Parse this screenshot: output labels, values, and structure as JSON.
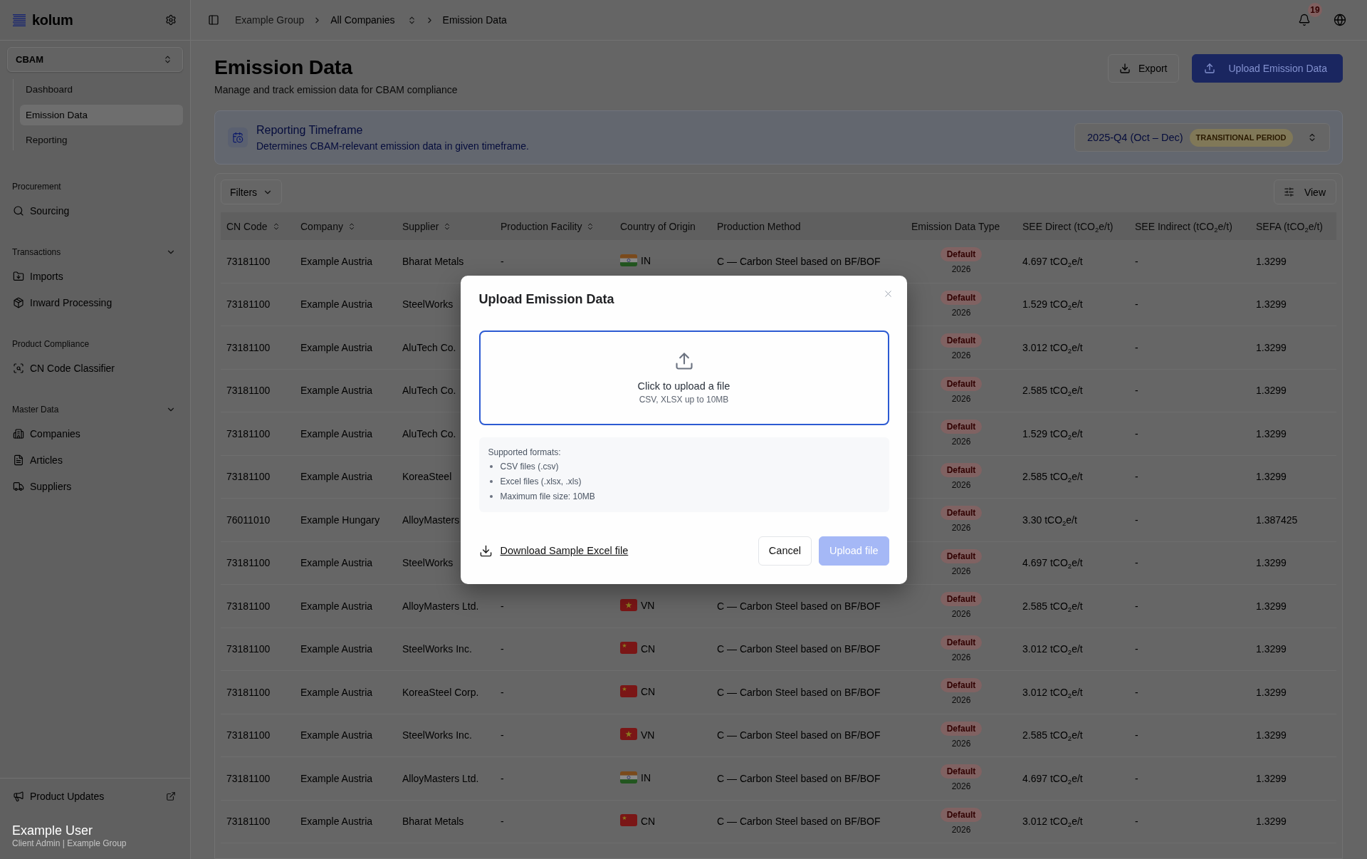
{
  "sidebar": {
    "logo": "kolum",
    "module": "CBAM",
    "module_items": [
      {
        "label": "Dashboard",
        "selected": false
      },
      {
        "label": "Emission Data",
        "selected": true
      },
      {
        "label": "Reporting",
        "selected": false
      }
    ],
    "sections": [
      {
        "title": "Procurement",
        "items": [
          {
            "label": "Sourcing",
            "selected": false
          }
        ]
      },
      {
        "title": "Transactions",
        "expanded": true,
        "items": [
          {
            "label": "Imports",
            "selected": false
          },
          {
            "label": "Inward Processing",
            "selected": false
          }
        ]
      },
      {
        "title": "Product Compliance",
        "items": [
          {
            "label": "CN Code Classifier",
            "selected": false
          }
        ]
      },
      {
        "title": "Master Data",
        "expanded": true,
        "items": [
          {
            "label": "Companies",
            "selected": false
          },
          {
            "label": "Articles",
            "selected": false
          },
          {
            "label": "Suppliers",
            "selected": false
          }
        ]
      }
    ],
    "product_updates": "Product Updates",
    "user": {
      "name": "Example User",
      "role": "Client Admin | Example Group"
    }
  },
  "header": {
    "breadcrumbs": [
      {
        "label": "Example Group",
        "kind": "link"
      },
      {
        "label": "All Companies",
        "kind": "switcher"
      },
      {
        "label": "Emission Data",
        "kind": "current"
      }
    ],
    "notification_count": "19"
  },
  "page": {
    "title": "Emission Data",
    "subtitle": "Manage and track emission data for CBAM compliance",
    "actions": [
      {
        "label": "Export",
        "kind": "secondary"
      },
      {
        "label": "Upload Emission Data",
        "kind": "primary"
      }
    ]
  },
  "reporting_timeframe": {
    "title": "Reporting Timeframe",
    "description": "Determines CBAM-relevant emission data in given timeframe.",
    "period": "2025-Q4 (Oct – Dec)",
    "period_badge": "TRANSITIONAL PERIOD"
  },
  "table": {
    "toolbar": {
      "filters": "Filters",
      "view": "View"
    },
    "columns": [
      {
        "label": "CN Code",
        "sortable": true
      },
      {
        "label": "Company",
        "sortable": true
      },
      {
        "label": "Supplier",
        "sortable": true
      },
      {
        "label": "Production Facility",
        "sortable": true
      },
      {
        "label": "Country of Origin",
        "sortable": false
      },
      {
        "label": "Production Method",
        "sortable": false
      },
      {
        "label": "Emission Data Type",
        "sortable": false
      },
      {
        "label": "SEE Direct (tCO$_{2}$e/t)",
        "sortable": false
      },
      {
        "label": "SEE Indirect (tCO$_{2}$e/t)",
        "sortable": false
      },
      {
        "label": "SEFA (tCO$_{2}$e/t)",
        "sortable": false
      }
    ],
    "rows": [
      {
        "cn_code": "73181100",
        "company": "Example Austria",
        "supplier": "Bharat Metals",
        "production_facility": "-",
        "country": {
          "code": "IN",
          "kind": "india"
        },
        "production_method": "C — Carbon Steel based on BF/BOF",
        "emission_data_type": {
          "label": "Default",
          "year": "2026"
        },
        "see_direct": "4.697 tCO$_{2}$e/t",
        "see_indirect": "-",
        "sefa": "1.3299"
      },
      {
        "cn_code": "73181100",
        "company": "Example Austria",
        "supplier": "SteelWorks",
        "emission_data_type": {
          "label": "Default",
          "year": "2026"
        },
        "see_direct": "1.529 tCO$_{2}$e/t",
        "see_indirect": "-",
        "sefa": "1.3299"
      },
      {
        "cn_code": "73181100",
        "company": "Example Austria",
        "supplier": "AluTech Co.",
        "emission_data_type": {
          "label": "Default",
          "year": "2026"
        },
        "see_direct": "3.012 tCO$_{2}$e/t",
        "see_indirect": "-",
        "sefa": "1.3299"
      },
      {
        "cn_code": "73181100",
        "company": "Example Austria",
        "supplier": "AluTech Co.",
        "emission_data_type": {
          "label": "Default",
          "year": "2026"
        },
        "see_direct": "2.585 tCO$_{2}$e/t",
        "see_indirect": "-",
        "sefa": "1.3299"
      },
      {
        "cn_code": "73181100",
        "company": "Example Austria",
        "supplier": "AluTech Co.",
        "emission_data_type": {
          "label": "Default",
          "year": "2026"
        },
        "see_direct": "1.529 tCO$_{2}$e/t",
        "see_indirect": "-",
        "sefa": "1.3299"
      },
      {
        "cn_code": "73181100",
        "company": "Example Austria",
        "supplier": "KoreaSteel",
        "emission_data_type": {
          "label": "Default",
          "year": "2026"
        },
        "see_direct": "2.585 tCO$_{2}$e/t",
        "see_indirect": "-",
        "sefa": "1.3299"
      },
      {
        "cn_code": "76011010",
        "company": "Example Hungary",
        "supplier": "AlloyMasters",
        "emission_data_type": {
          "label": "Default",
          "year": "2026"
        },
        "see_direct": "3.30 tCO$_{2}$e/t",
        "see_indirect": "-",
        "sefa": "1.387425"
      },
      {
        "cn_code": "73181100",
        "company": "Example Austria",
        "supplier": "SteelWorks",
        "emission_data_type": {
          "label": "Default",
          "year": "2026"
        },
        "see_direct": "4.697 tCO$_{2}$e/t",
        "see_indirect": "-",
        "sefa": "1.3299"
      },
      {
        "cn_code": "73181100",
        "company": "Example Austria",
        "supplier": "AlloyMasters Ltd.",
        "production_facility": "-",
        "country": {
          "code": "VN",
          "kind": "vietnam"
        },
        "production_method": "C — Carbon Steel based on BF/BOF",
        "emission_data_type": {
          "label": "Default",
          "year": "2026"
        },
        "see_direct": "2.585 tCO$_{2}$e/t",
        "see_indirect": "-",
        "sefa": "1.3299"
      },
      {
        "cn_code": "73181100",
        "company": "Example Austria",
        "supplier": "SteelWorks Inc.",
        "production_facility": "-",
        "country": {
          "code": "CN",
          "kind": "china"
        },
        "production_method": "C — Carbon Steel based on BF/BOF",
        "emission_data_type": {
          "label": "Default",
          "year": "2026"
        },
        "see_direct": "3.012 tCO$_{2}$e/t",
        "see_indirect": "-",
        "sefa": "1.3299"
      },
      {
        "cn_code": "73181100",
        "company": "Example Austria",
        "supplier": "KoreaSteel Corp.",
        "production_facility": "-",
        "country": {
          "code": "CN",
          "kind": "china"
        },
        "production_method": "C — Carbon Steel based on BF/BOF",
        "emission_data_type": {
          "label": "Default",
          "year": "2026"
        },
        "see_direct": "3.012 tCO$_{2}$e/t",
        "see_indirect": "-",
        "sefa": "1.3299"
      },
      {
        "cn_code": "73181100",
        "company": "Example Austria",
        "supplier": "SteelWorks Inc.",
        "production_facility": "-",
        "country": {
          "code": "VN",
          "kind": "vietnam"
        },
        "production_method": "C — Carbon Steel based on BF/BOF",
        "emission_data_type": {
          "label": "Default",
          "year": "2026"
        },
        "see_direct": "2.585 tCO$_{2}$e/t",
        "see_indirect": "-",
        "sefa": "1.3299"
      },
      {
        "cn_code": "73181100",
        "company": "Example Austria",
        "supplier": "AlloyMasters Ltd.",
        "production_facility": "-",
        "country": {
          "code": "IN",
          "kind": "india"
        },
        "production_method": "C — Carbon Steel based on BF/BOF",
        "emission_data_type": {
          "label": "Default",
          "year": "2026"
        },
        "see_direct": "4.697 tCO$_{2}$e/t",
        "see_indirect": "-",
        "sefa": "1.3299"
      },
      {
        "cn_code": "73181100",
        "company": "Example Austria",
        "supplier": "Bharat Metals",
        "production_facility": "-",
        "country": {
          "code": "CN",
          "kind": "china"
        },
        "production_method": "C — Carbon Steel based on BF/BOF",
        "emission_data_type": {
          "label": "Default",
          "year": "2026"
        },
        "see_direct": "3.012 tCO$_{2}$e/t",
        "see_indirect": "-",
        "sefa": "1.3299"
      }
    ]
  },
  "modal": {
    "title": "Upload Emission Data",
    "dropzone": {
      "title": "Click to upload a file",
      "hint": "CSV, XLSX up to 10MB"
    },
    "formats": {
      "title": "Supported formats:",
      "items": [
        "CSV files (.csv)",
        "Excel files (.xlsx, .xls)",
        "Maximum file size: 10MB"
      ]
    },
    "download_link": "Download Sample Excel file",
    "buttons": [
      {
        "label": "Cancel",
        "kind": "secondary",
        "disabled": false
      },
      {
        "label": "Upload file",
        "kind": "primary",
        "disabled": true
      }
    ]
  }
}
